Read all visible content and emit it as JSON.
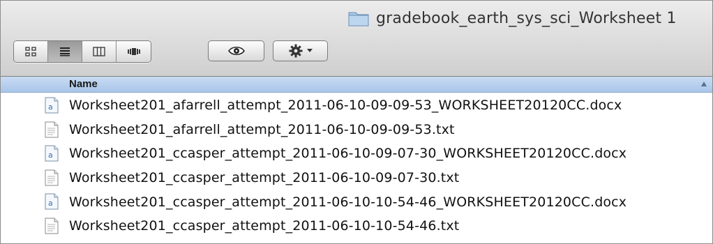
{
  "window": {
    "title": "gradebook_earth_sys_sci_Worksheet 1",
    "title_icon": "folder-icon"
  },
  "toolbar": {
    "view_buttons": [
      {
        "name": "icon-view",
        "icon": "grid-icon",
        "active": false
      },
      {
        "name": "list-view",
        "icon": "list-icon",
        "active": true
      },
      {
        "name": "column-view",
        "icon": "columns-icon",
        "active": false
      },
      {
        "name": "coverflow-view",
        "icon": "coverflow-icon",
        "active": false
      }
    ],
    "quicklook_icon": "eye-icon",
    "action_icon": "gear-icon",
    "action_dropdown_icon": "chevron-down-icon"
  },
  "list": {
    "header": {
      "name_label": "Name",
      "sort": "ascending"
    },
    "files": [
      {
        "name": "Worksheet201_afarrell_attempt_2011-06-10-09-09-53_WORKSHEET20120CC.docx",
        "icon": "docx-icon"
      },
      {
        "name": "Worksheet201_afarrell_attempt_2011-06-10-09-09-53.txt",
        "icon": "txt-icon"
      },
      {
        "name": "Worksheet201_ccasper_attempt_2011-06-10-09-07-30_WORKSHEET20120CC.docx",
        "icon": "docx-icon"
      },
      {
        "name": "Worksheet201_ccasper_attempt_2011-06-10-09-07-30.txt",
        "icon": "txt-icon"
      },
      {
        "name": "Worksheet201_ccasper_attempt_2011-06-10-10-54-46_WORKSHEET20120CC.docx",
        "icon": "docx-icon"
      },
      {
        "name": "Worksheet201_ccasper_attempt_2011-06-10-10-54-46.txt",
        "icon": "txt-icon"
      }
    ]
  },
  "colors": {
    "header_blue": "#b8d0ee",
    "toolbar_gray": "#dcdcdc"
  }
}
